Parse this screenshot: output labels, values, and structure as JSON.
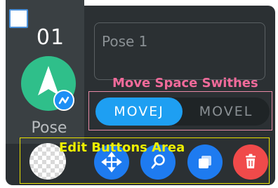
{
  "pose": {
    "number": "01",
    "label": "Pose",
    "name_placeholder": "Pose 1"
  },
  "move_space": {
    "annotation": "Move Space Swithes",
    "options": [
      "MOVEJ",
      "MOVEL"
    ],
    "selected": "MOVEJ"
  },
  "edit_buttons": {
    "annotation": "Edit Buttons Area",
    "icons": [
      "transparency-checker-icon",
      "move-arrows-icon",
      "search-icon",
      "copy-icon",
      "trash-icon"
    ]
  },
  "colors": {
    "accent": "#1e9ff2",
    "delete": "#f04a4a",
    "avatar": "#2fbf8a",
    "annotation_move": "#f06a9a",
    "annotation_edit": "#eef000"
  }
}
